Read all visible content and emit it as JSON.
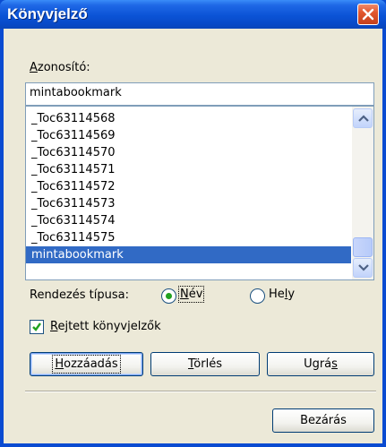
{
  "window": {
    "title": "Könyvjelző"
  },
  "identifier": {
    "label": "Azonosító:",
    "value": "mintabookmark"
  },
  "bookmarks": [
    "_Toc63114568",
    "_Toc63114569",
    "_Toc63114570",
    "_Toc63114571",
    "_Toc63114572",
    "_Toc63114573",
    "_Toc63114574",
    "_Toc63114575",
    "mintabookmark"
  ],
  "selected_bookmark": "mintabookmark",
  "sort": {
    "label": "Rendezés típusa:",
    "options": [
      "Név",
      "Hely"
    ],
    "selected": "Név"
  },
  "hidden_bookmarks": {
    "label": "Rejtett könyvjelzők",
    "checked": true
  },
  "buttons": {
    "add": "Hozzáadás",
    "delete": "Törlés",
    "goto": "Ugrás",
    "close": "Bezárás"
  },
  "colors": {
    "titlebar": "#0b53d6",
    "selection": "#316ac5",
    "dialog_bg": "#ece9d8",
    "radio_dot": "#21a121",
    "close_button": "#e2572f"
  },
  "icons": {
    "close": "close-x-icon",
    "scroll_up": "chevron-up-icon",
    "scroll_down": "chevron-down-icon",
    "check": "checkmark-icon"
  }
}
